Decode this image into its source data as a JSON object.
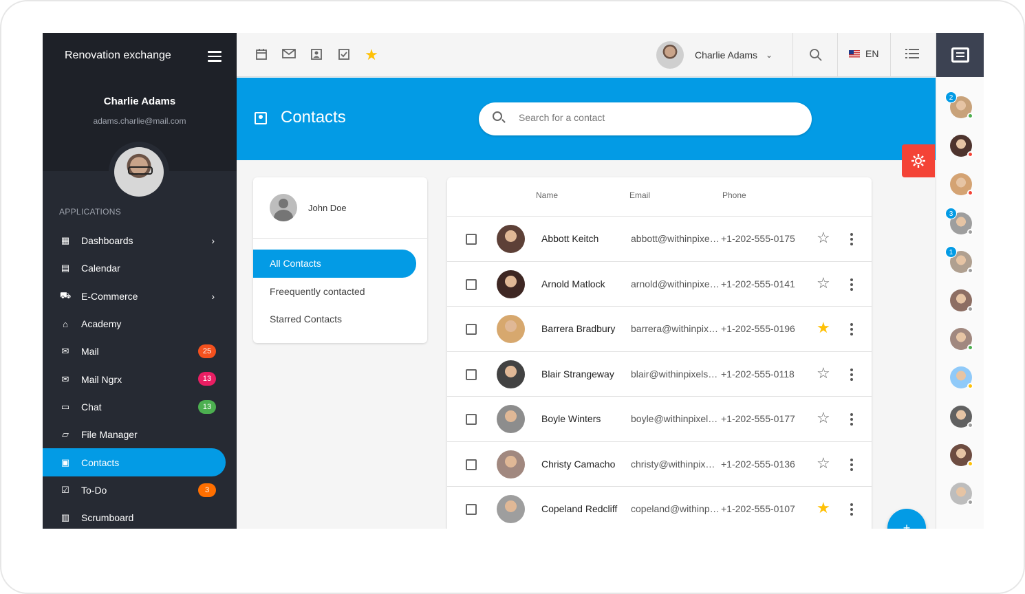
{
  "app": {
    "brand": "Renovation exchange",
    "user_name": "Charlie Adams",
    "user_email": "adams.charlie@mail.com"
  },
  "sidebar": {
    "section_label": "APPLICATIONS",
    "items": [
      {
        "label": "Dashboards",
        "icon": "dashboard-icon",
        "chevron": true
      },
      {
        "label": "Calendar",
        "icon": "calendar-icon"
      },
      {
        "label": "E-Commerce",
        "icon": "cart-icon",
        "chevron": true
      },
      {
        "label": "Academy",
        "icon": "school-icon"
      },
      {
        "label": "Mail",
        "icon": "mail-icon",
        "badge": "25",
        "badge_color": "#f4511e"
      },
      {
        "label": "Mail Ngrx",
        "icon": "mail-icon",
        "badge": "13",
        "badge_color": "#e91e63"
      },
      {
        "label": "Chat",
        "icon": "chat-icon",
        "badge": "13",
        "badge_color": "#4caf50"
      },
      {
        "label": "File Manager",
        "icon": "folder-icon"
      },
      {
        "label": "Contacts",
        "icon": "contacts-icon",
        "active": true
      },
      {
        "label": "To-Do",
        "icon": "checkbox-icon",
        "badge": "3",
        "badge_color": "#ff6f00"
      },
      {
        "label": "Scrumboard",
        "icon": "board-icon"
      }
    ]
  },
  "toolbar": {
    "user_name": "Charlie Adams",
    "language": "EN",
    "shortcuts": [
      "calendar-icon",
      "mail-icon",
      "contacts-icon",
      "checkbox-icon",
      "star-icon"
    ]
  },
  "header": {
    "title": "Contacts",
    "search_placeholder": "Search for a contact"
  },
  "side_card": {
    "user": "John Doe",
    "menu": [
      {
        "label": "All Contacts",
        "active": true
      },
      {
        "label": "Freequently contacted"
      },
      {
        "label": "Starred Contacts"
      }
    ]
  },
  "table": {
    "columns": {
      "name": "Name",
      "email": "Email",
      "phone": "Phone"
    },
    "rows": [
      {
        "name": "Abbott Keitch",
        "email": "abbott@withinpixels.com",
        "phone": "+1-202-555-0175",
        "starred": false,
        "avatar_color": "#5d4037"
      },
      {
        "name": "Arnold Matlock",
        "email": "arnold@withinpixels.com",
        "phone": "+1-202-555-0141",
        "starred": false,
        "avatar_color": "#3e2723"
      },
      {
        "name": "Barrera Bradbury",
        "email": "barrera@withinpixels.com",
        "phone": "+1-202-555-0196",
        "starred": true,
        "avatar_color": "#d7a86e"
      },
      {
        "name": "Blair Strangeway",
        "email": "blair@withinpixels.com",
        "phone": "+1-202-555-0118",
        "starred": false,
        "avatar_color": "#424242"
      },
      {
        "name": "Boyle Winters",
        "email": "boyle@withinpixels.com",
        "phone": "+1-202-555-0177",
        "starred": false,
        "avatar_color": "#8d8d8d"
      },
      {
        "name": "Christy Camacho",
        "email": "christy@withinpixels.com",
        "phone": "+1-202-555-0136",
        "starred": false,
        "avatar_color": "#a1887f"
      },
      {
        "name": "Copeland Redcliff",
        "email": "copeland@withinpixels.com",
        "phone": "+1-202-555-0107",
        "starred": true,
        "avatar_color": "#9e9e9e"
      }
    ]
  },
  "chat_contacts": [
    {
      "unread": "2",
      "status_color": "#4caf50",
      "avatar_color": "#c8a27a"
    },
    {
      "unread": "",
      "status_color": "#f44336",
      "avatar_color": "#4e342e"
    },
    {
      "unread": "",
      "status_color": "#f44336",
      "avatar_color": "#d4a373"
    },
    {
      "unread": "3",
      "status_color": "#9e9e9e",
      "avatar_color": "#9e9e9e"
    },
    {
      "unread": "1",
      "status_color": "#9e9e9e",
      "avatar_color": "#b0a090"
    },
    {
      "unread": "",
      "status_color": "#9e9e9e",
      "avatar_color": "#8d6e63"
    },
    {
      "unread": "",
      "status_color": "#4caf50",
      "avatar_color": "#a1887f"
    },
    {
      "unread": "",
      "status_color": "#ffc107",
      "avatar_color": "#90caf9"
    },
    {
      "unread": "",
      "status_color": "#9e9e9e",
      "avatar_color": "#616161"
    },
    {
      "unread": "",
      "status_color": "#ffc107",
      "avatar_color": "#6d4c41"
    },
    {
      "unread": "",
      "status_color": "#9e9e9e",
      "avatar_color": "#bdbdbd"
    }
  ],
  "colors": {
    "accent": "#039be5",
    "sidebar": "#262a33",
    "star": "#ffc107",
    "settings": "#f44336"
  }
}
